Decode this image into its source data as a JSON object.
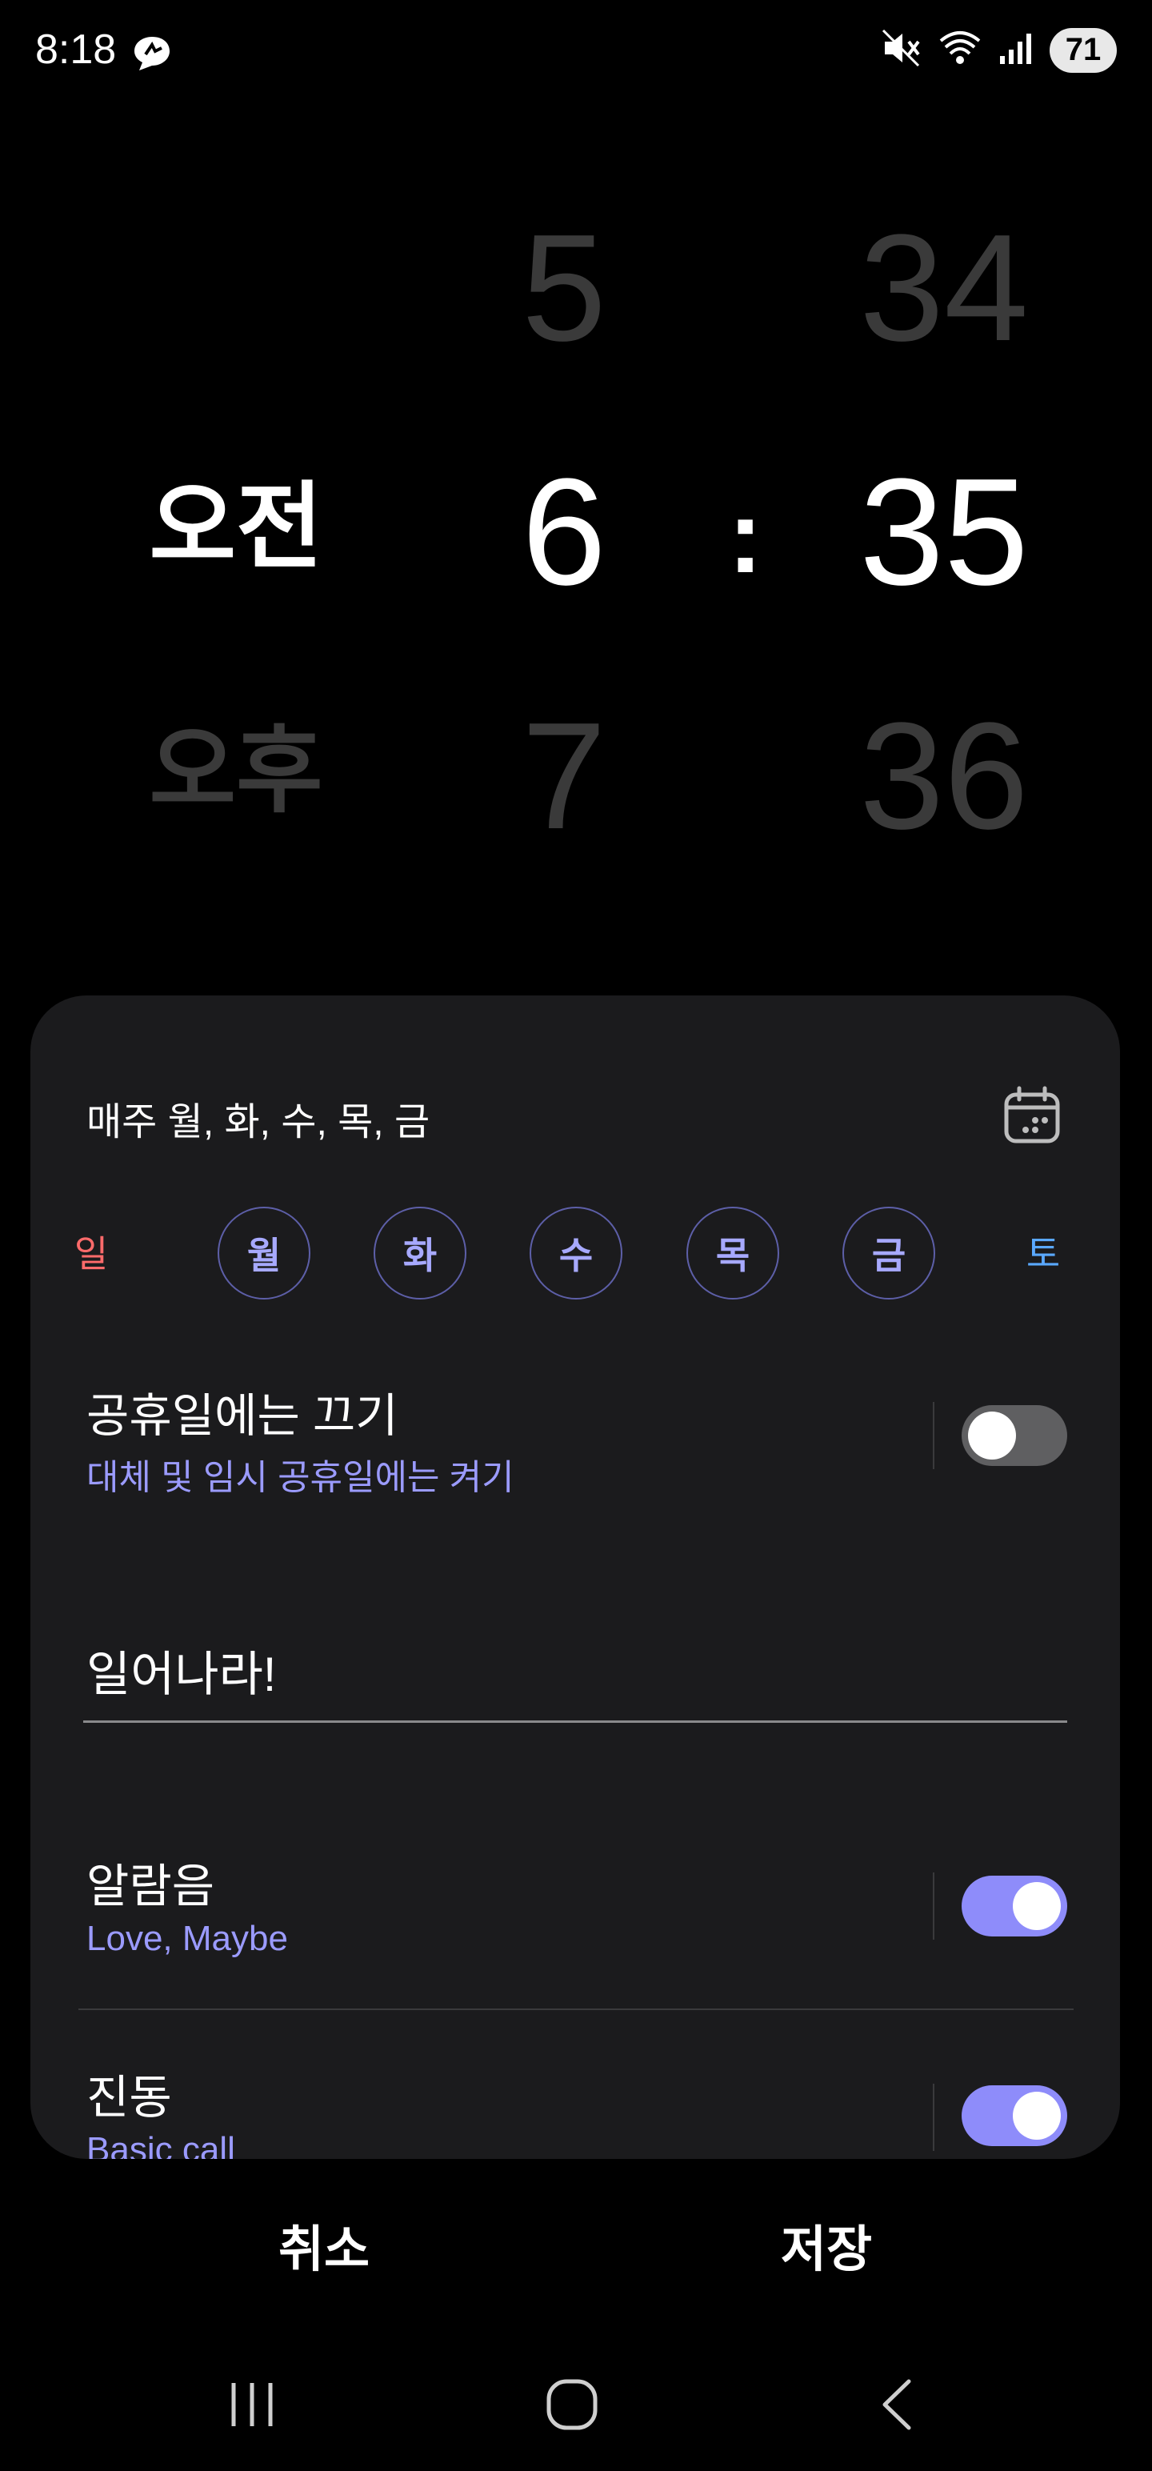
{
  "status_bar": {
    "time": "8:18",
    "battery": "71"
  },
  "picker": {
    "ampm": {
      "selected": "오전",
      "next": "오후"
    },
    "hour": {
      "prev": "5",
      "selected": "6",
      "next": "7"
    },
    "separator": ":",
    "minute": {
      "prev": "34",
      "selected": "35",
      "next": "36"
    }
  },
  "repeat": {
    "text": "매주 월, 화, 수, 목, 금"
  },
  "days": [
    {
      "label": "일",
      "selected": false,
      "color": "#ff6b6b"
    },
    {
      "label": "월",
      "selected": true,
      "color": "#a7a9ff"
    },
    {
      "label": "화",
      "selected": true,
      "color": "#a7a9ff"
    },
    {
      "label": "수",
      "selected": true,
      "color": "#a7a9ff"
    },
    {
      "label": "목",
      "selected": true,
      "color": "#a7a9ff"
    },
    {
      "label": "금",
      "selected": true,
      "color": "#a7a9ff"
    },
    {
      "label": "토",
      "selected": false,
      "color": "#5aa8ff"
    }
  ],
  "holiday": {
    "title": "공휴일에는 끄기",
    "subtitle": "대체 및 임시 공휴일에는 켜기",
    "enabled": false
  },
  "alarm_name": {
    "value": "일어나라!"
  },
  "sound": {
    "title": "알람음",
    "subtitle": "Love, Maybe",
    "enabled": true
  },
  "vibration": {
    "title": "진동",
    "subtitle": "Basic call",
    "enabled": true
  },
  "actions": {
    "cancel": "취소",
    "save": "저장"
  },
  "colors": {
    "accent": "#8e8cfa",
    "sub_text": "#9b9bff",
    "card_bg": "#1b1b1d"
  }
}
